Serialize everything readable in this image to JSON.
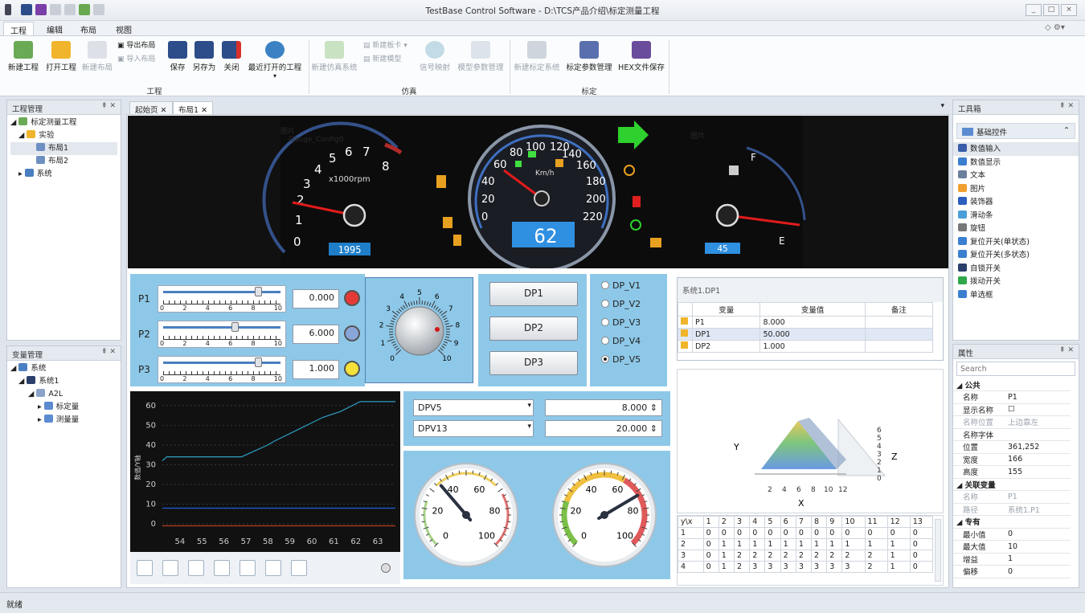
{
  "window": {
    "title": "TestBase Control Software - D:\\TCS产品介绍\\标定测量工程",
    "controls": [
      "_",
      "□",
      "×"
    ]
  },
  "menu": {
    "tabs": [
      "工程",
      "编辑",
      "布局",
      "视图"
    ],
    "active": "工程"
  },
  "ribbon": {
    "groups": {
      "g1": "工程",
      "g2": "仿真",
      "g3": "标定"
    },
    "new_project": "新建工程",
    "open_project": "打开工程",
    "new_layout": "新建布局",
    "export_layout": "导出布局",
    "import_layout": "导入布局",
    "save": "保存",
    "save_as": "另存为",
    "close": "关闭",
    "recent": "最近打开的工程",
    "new_sim": "新建仿真系统",
    "new_board": "新建板卡",
    "new_model": "新建模型",
    "signal_map": "信号映射",
    "model_params": "模型参数管理",
    "new_cal": "新建标定系统",
    "cal_params": "标定参数管理",
    "hex_save": "HEX文件保存"
  },
  "project_panel": {
    "title": "工程管理",
    "items": [
      "标定测量工程",
      "实验",
      "布局1",
      "布局2",
      "系统"
    ]
  },
  "var_panel": {
    "title": "变量管理",
    "items": [
      "系统",
      "系统1",
      "A2L",
      "标定量",
      "测量量"
    ]
  },
  "doc_tabs": [
    "起始页",
    "布局1"
  ],
  "dashboard": {
    "label_left": "图片",
    "label_left2": "Gauge_Config0",
    "label_right": "图片",
    "tacho_ticks": [
      "0",
      "1",
      "2",
      "3",
      "4",
      "5",
      "6",
      "7",
      "8"
    ],
    "tacho_unit": "x1000rpm",
    "tacho_value": "1995",
    "speed_ticks": [
      "0",
      "20",
      "40",
      "60",
      "80",
      "100",
      "120",
      "140",
      "160",
      "180",
      "200",
      "220"
    ],
    "speed_unit": "Km/h",
    "speed_value": "62",
    "fuel_f": "F",
    "fuel_e": "E",
    "fuel_value": "45"
  },
  "sliders": [
    {
      "name": "P1",
      "value": "0.000",
      "level": 0.8,
      "led": "#e53935"
    },
    {
      "name": "P2",
      "value": "6.000",
      "level": 0.6,
      "led": "#8aa6d8"
    },
    {
      "name": "P3",
      "value": "1.000",
      "level": 0.8,
      "led": "#f4e23a"
    }
  ],
  "slider_ticks": [
    "0",
    "2",
    "4",
    "6",
    "8",
    "10"
  ],
  "knob_ticks": [
    "0",
    "1",
    "2",
    "3",
    "4",
    "5",
    "6",
    "7",
    "8",
    "9",
    "10"
  ],
  "dp_buttons": [
    "DP1",
    "DP2",
    "DP3"
  ],
  "radios": {
    "options": [
      "DP_V1",
      "DP_V2",
      "DP_V3",
      "DP_V4",
      "DP_V5"
    ],
    "selected": "DP_V5"
  },
  "var_table": {
    "title": "系统1.DP1",
    "headers": [
      "变量",
      "变量值",
      "备注"
    ],
    "rows": [
      [
        "P1",
        "8.000",
        ""
      ],
      [
        "DP1",
        "50.000",
        ""
      ],
      [
        "DP2",
        "1.000",
        ""
      ]
    ]
  },
  "chart_data": {
    "type": "line",
    "ylabel": "数值/Y轴",
    "x_ticks": [
      "54",
      "55",
      "56",
      "57",
      "58",
      "59",
      "60",
      "61",
      "62",
      "63"
    ],
    "y_ticks": [
      "0",
      "10",
      "20",
      "30",
      "40",
      "50",
      "60"
    ],
    "ylim": [
      -2,
      64
    ],
    "series": [
      {
        "color": "#2f9fc4",
        "x": [
          53.2,
          53.4,
          56.8,
          58.0,
          58.3,
          60.5,
          61.3,
          62.2,
          63.8
        ],
        "y": [
          32,
          34,
          34,
          40,
          42,
          54,
          57,
          62,
          62
        ]
      },
      {
        "color": "#1f5fd8",
        "x": [
          53.2,
          63.8
        ],
        "y": [
          8,
          8
        ]
      },
      {
        "color": "#b24020",
        "x": [
          53.2,
          63.8
        ],
        "y": [
          -1,
          -1
        ]
      }
    ]
  },
  "chart_toolbar": [
    "play-icon",
    "save-icon",
    "eye-icon",
    "image-icon",
    "zoom-icon",
    "pan-icon",
    "fit-icon"
  ],
  "combos": [
    {
      "name": "DPV5",
      "value": "8.000"
    },
    {
      "name": "DPV13",
      "value": "20.000"
    }
  ],
  "gauges": {
    "left_ticks": [
      "0",
      "20",
      "40",
      "60",
      "80",
      "100"
    ],
    "right_ticks": [
      "0",
      "20",
      "40",
      "60",
      "80",
      "100"
    ],
    "left_value": 35,
    "right_value": 72
  },
  "surface": {
    "axis_x": "X",
    "axis_y": "Y",
    "axis_z": "Z",
    "x_ticks": [
      "2",
      "4",
      "6",
      "8",
      "10",
      "12"
    ],
    "z_ticks": [
      "0",
      "1",
      "2",
      "3",
      "4",
      "5",
      "6"
    ]
  },
  "map_table": {
    "header": [
      "y\\x",
      "1",
      "2",
      "3",
      "4",
      "5",
      "6",
      "7",
      "8",
      "9",
      "10",
      "11",
      "12",
      "13"
    ],
    "rows": [
      [
        "1",
        "0",
        "0",
        "0",
        "0",
        "0",
        "0",
        "0",
        "0",
        "0",
        "0",
        "0",
        "0",
        "0"
      ],
      [
        "2",
        "0",
        "1",
        "1",
        "1",
        "1",
        "1",
        "1",
        "1",
        "1",
        "1",
        "1",
        "1",
        "0"
      ],
      [
        "3",
        "0",
        "1",
        "2",
        "2",
        "2",
        "2",
        "2",
        "2",
        "2",
        "2",
        "2",
        "1",
        "0"
      ],
      [
        "4",
        "0",
        "1",
        "2",
        "3",
        "3",
        "3",
        "3",
        "3",
        "3",
        "3",
        "2",
        "1",
        "0"
      ]
    ]
  },
  "toolbox": {
    "title": "工具箱",
    "section": "基础控件",
    "items": [
      "数值输入",
      "数值显示",
      "文本",
      "图片",
      "装饰器",
      "滑动条",
      "旋钮",
      "复位开关(单状态)",
      "复位开关(多状态)",
      "自锁开关",
      "拨动开关",
      "单选框"
    ]
  },
  "props": {
    "title": "属性",
    "search_placeholder": "Search",
    "rows": [
      {
        "k": "公共",
        "v": "",
        "cat": true
      },
      {
        "k": "名称",
        "v": "P1"
      },
      {
        "k": "显示名称",
        "v": "☐"
      },
      {
        "k": "名称位置",
        "v": "上边靠左",
        "dim": true
      },
      {
        "k": "名称字体",
        "v": ""
      },
      {
        "k": "位置",
        "v": "361,252"
      },
      {
        "k": "宽度",
        "v": "166"
      },
      {
        "k": "高度",
        "v": "155"
      },
      {
        "k": "关联变量",
        "v": "",
        "cat": true
      },
      {
        "k": "名称",
        "v": "P1",
        "dim": true
      },
      {
        "k": "路径",
        "v": "系统1.P1",
        "dim": true
      },
      {
        "k": "专有",
        "v": "",
        "cat": true
      },
      {
        "k": "最小值",
        "v": "0"
      },
      {
        "k": "最大值",
        "v": "10"
      },
      {
        "k": "增益",
        "v": "1"
      },
      {
        "k": "偏移",
        "v": "0"
      }
    ]
  },
  "status": "就绪"
}
